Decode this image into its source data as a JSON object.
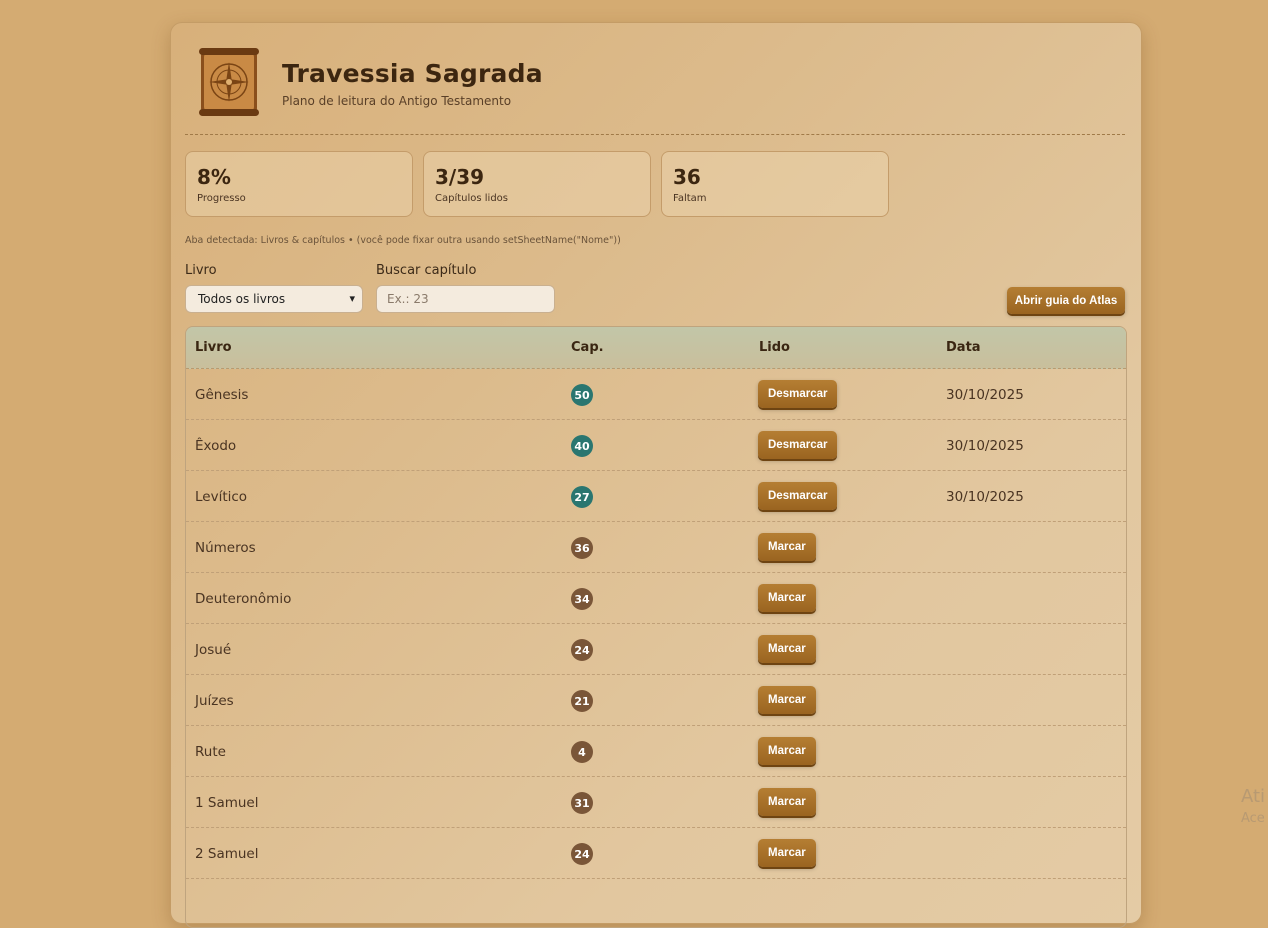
{
  "header": {
    "title": "Travessia Sagrada",
    "subtitle": "Plano de leitura do Antigo Testamento",
    "logo": "compass-scroll-logo"
  },
  "stats": [
    {
      "value": "8%",
      "label": "Progresso"
    },
    {
      "value": "3/39",
      "label": "Capítulos lidos"
    },
    {
      "value": "36",
      "label": "Faltam"
    }
  ],
  "hint": "Aba detectada: Livros & capítulos • (você pode fixar outra usando setSheetName(\"Nome\"))",
  "filters": {
    "book_label": "Livro",
    "book_selected": "Todos os livros",
    "search_label": "Buscar capítulo",
    "search_placeholder": "Ex.: 23",
    "search_value": ""
  },
  "atlas_button": "Abrir guia do Atlas",
  "table": {
    "columns": [
      "Livro",
      "Cap.",
      "Lido",
      "Data"
    ],
    "rows": [
      {
        "book": "Gênesis",
        "cap": "50",
        "read": true,
        "action": "Desmarcar",
        "date": "30/10/2025"
      },
      {
        "book": "Êxodo",
        "cap": "40",
        "read": true,
        "action": "Desmarcar",
        "date": "30/10/2025"
      },
      {
        "book": "Levítico",
        "cap": "27",
        "read": true,
        "action": "Desmarcar",
        "date": "30/10/2025"
      },
      {
        "book": "Números",
        "cap": "36",
        "read": false,
        "action": "Marcar",
        "date": ""
      },
      {
        "book": "Deuteronômio",
        "cap": "34",
        "read": false,
        "action": "Marcar",
        "date": ""
      },
      {
        "book": "Josué",
        "cap": "24",
        "read": false,
        "action": "Marcar",
        "date": ""
      },
      {
        "book": "Juízes",
        "cap": "21",
        "read": false,
        "action": "Marcar",
        "date": ""
      },
      {
        "book": "Rute",
        "cap": "4",
        "read": false,
        "action": "Marcar",
        "date": ""
      },
      {
        "book": "1 Samuel",
        "cap": "31",
        "read": false,
        "action": "Marcar",
        "date": ""
      },
      {
        "book": "2 Samuel",
        "cap": "24",
        "read": false,
        "action": "Marcar",
        "date": ""
      }
    ]
  },
  "watermark": {
    "line1": "Ati",
    "line2": "Ace"
  },
  "colors": {
    "read_badge": "#2a7670",
    "unread_badge": "#7a5638",
    "button": "#a86e26"
  }
}
